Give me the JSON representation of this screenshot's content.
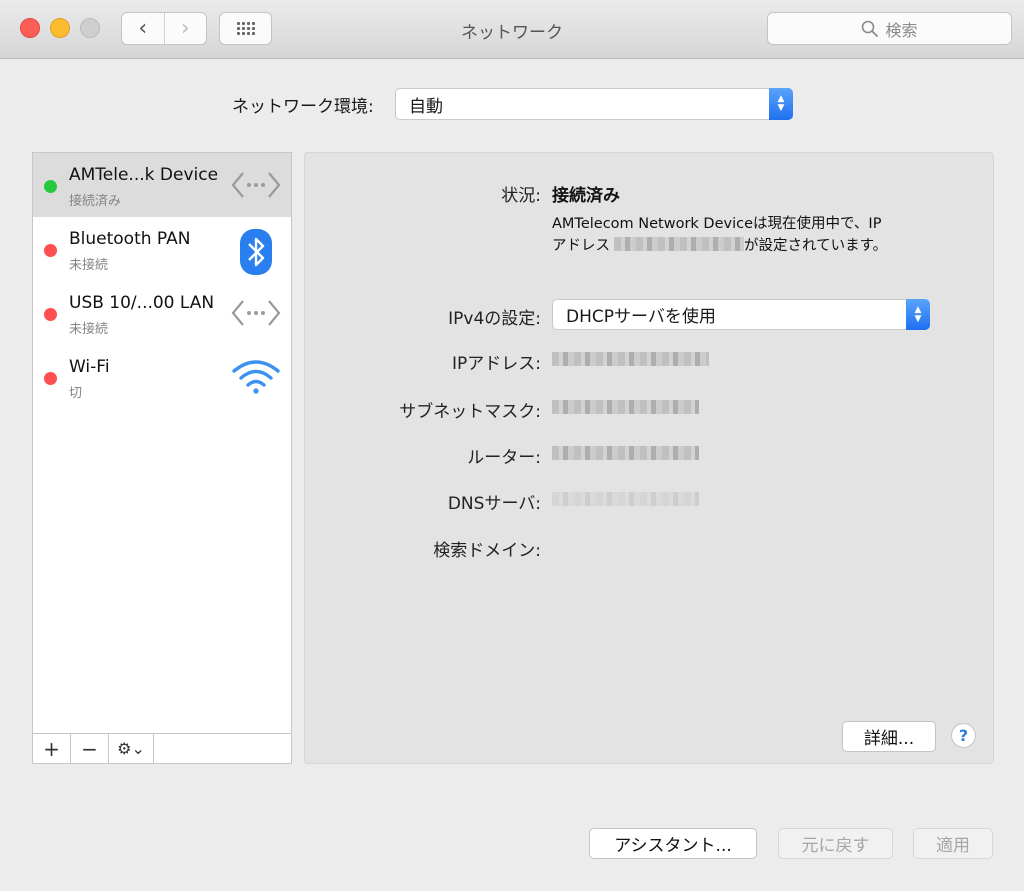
{
  "window": {
    "title": "ネットワーク"
  },
  "toolbar": {
    "search_placeholder": "検索"
  },
  "location": {
    "label": "ネットワーク環境:",
    "value": "自動"
  },
  "services": [
    {
      "name": "AMTele...k Device",
      "status": "接続済み",
      "status_color": "#27c93f",
      "icon": "ethernet-icon",
      "selected": true
    },
    {
      "name": "Bluetooth PAN",
      "status": "未接続",
      "status_color": "#fc4f4f",
      "icon": "bluetooth-icon"
    },
    {
      "name": "USB 10/...00 LAN",
      "status": "未接続",
      "status_color": "#fc4f4f",
      "icon": "ethernet-icon"
    },
    {
      "name": "Wi-Fi",
      "status": "切",
      "status_color": "#fc4f4f",
      "icon": "wifi-icon"
    }
  ],
  "sidebar_buttons": {
    "add": "+",
    "remove": "−",
    "gear": "⚙︎⌄"
  },
  "detail": {
    "status_label": "状況:",
    "status_value": "接続済み",
    "status_desc_1": "AMTelecom Network Deviceは現在使用中で、IP",
    "status_desc_2a": "アドレス",
    "status_desc_2b": "が設定されています。",
    "ipv4_label": "IPv4の設定:",
    "ipv4_value": "DHCPサーバを使用",
    "ip_label": "IPアドレス:",
    "subnet_label": "サブネットマスク:",
    "router_label": "ルーター:",
    "dns_label": "DNSサーバ:",
    "search_domain_label": "検索ドメイン:",
    "advanced_button": "詳細...",
    "help_button": "?"
  },
  "footer": {
    "assistant": "アシスタント...",
    "revert": "元に戻す",
    "apply": "適用"
  },
  "colors": {
    "accent": "#1f6ff0",
    "connected": "#27c93f",
    "disconnected": "#fc4f4f"
  }
}
